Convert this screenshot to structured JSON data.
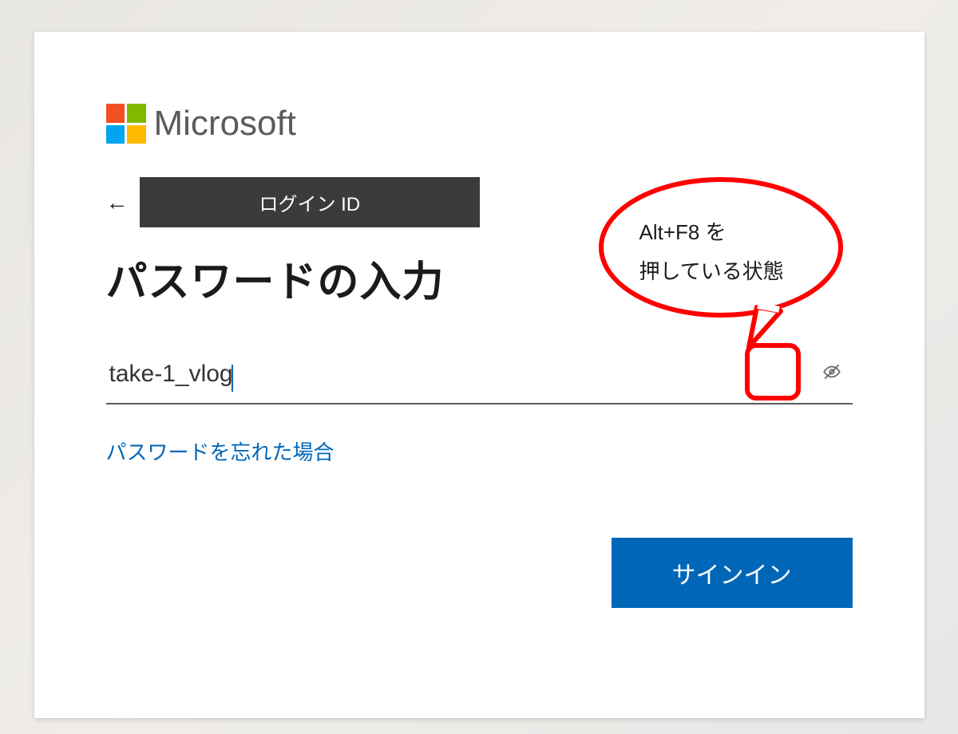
{
  "brand": {
    "name": "Microsoft"
  },
  "identity": {
    "back_arrow": "←",
    "login_id_label": "ログイン ID"
  },
  "title": "パスワードの入力",
  "password": {
    "value": "take-1_vlog"
  },
  "links": {
    "forgot": "パスワードを忘れた場合"
  },
  "actions": {
    "signin": "サインイン"
  },
  "annotation": {
    "line1": "Alt+F8 を",
    "line2": "押している状態"
  }
}
